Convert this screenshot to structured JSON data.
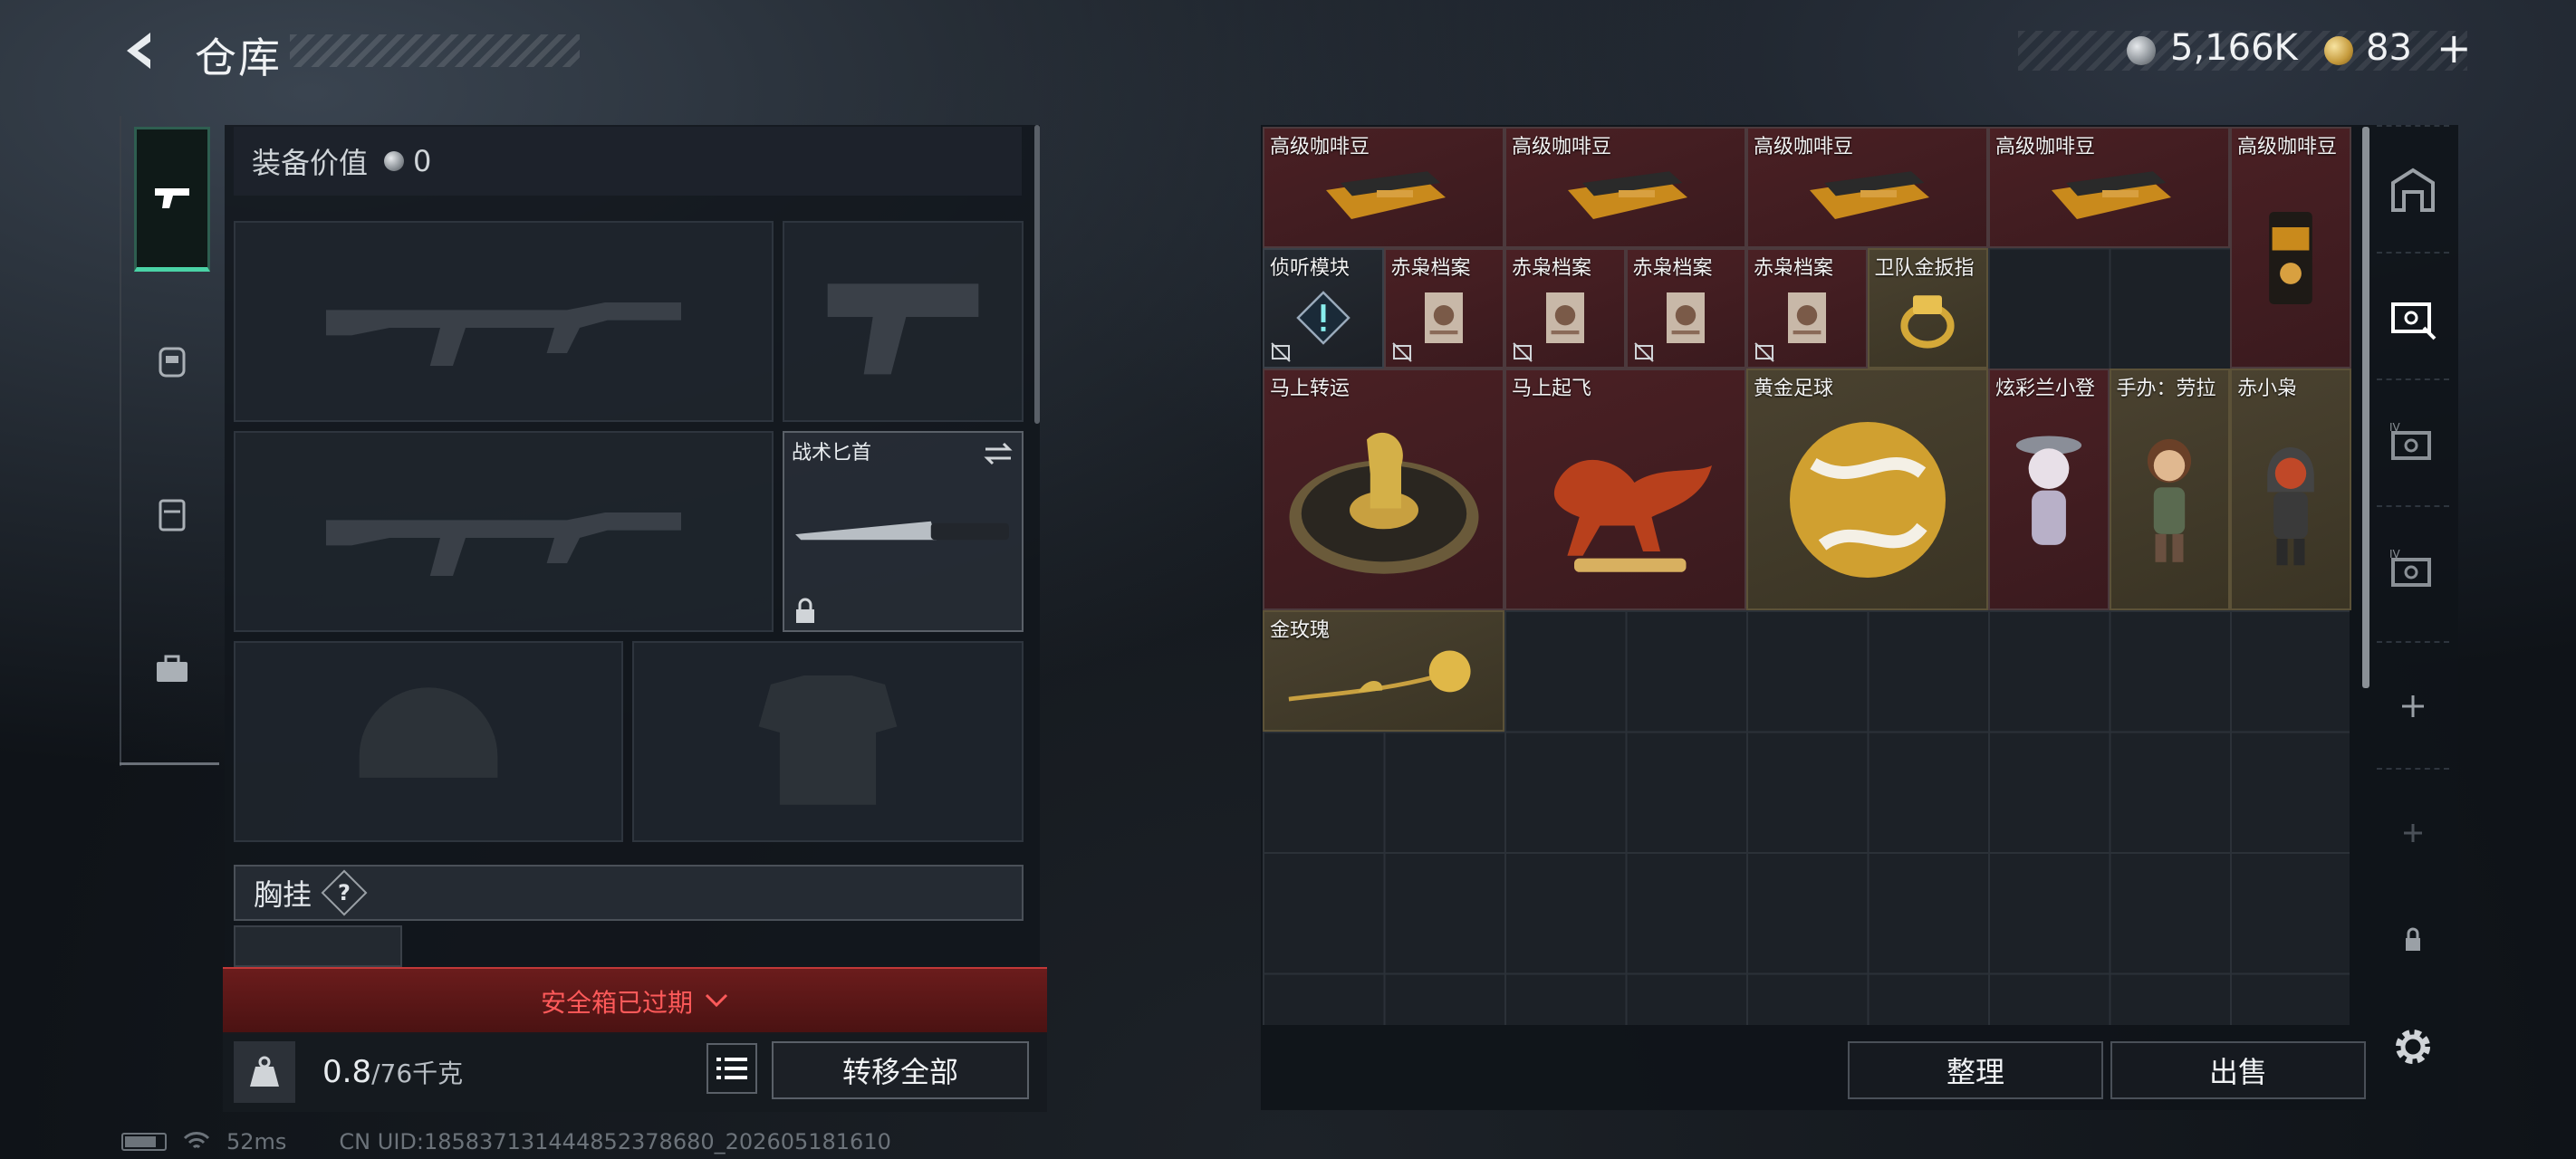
{
  "header": {
    "title": "仓库"
  },
  "currency": {
    "silver": "5,166K",
    "gold": "83",
    "add_label": "+"
  },
  "equipment": {
    "value_label": "装备价值",
    "value": "0",
    "melee_label": "战术匕首",
    "chest_label": "胸挂",
    "chest_help": "?",
    "safebox_expired": "安全箱已过期",
    "weight_current": "0.8",
    "weight_max": "/76千克",
    "transfer_all": "转移全部"
  },
  "inventory": {
    "items": [
      {
        "label": "高级咖啡豆",
        "type": "coffee"
      },
      {
        "label": "高级咖啡豆",
        "type": "coffee"
      },
      {
        "label": "高级咖啡豆",
        "type": "coffee"
      },
      {
        "label": "高级咖啡豆",
        "type": "coffee"
      },
      {
        "label": "高级咖啡豆",
        "type": "coffee-bag"
      },
      {
        "label": "侦听模块",
        "type": "module"
      },
      {
        "label": "赤枭档案",
        "type": "file"
      },
      {
        "label": "赤枭档案",
        "type": "file"
      },
      {
        "label": "赤枭档案",
        "type": "file"
      },
      {
        "label": "赤枭档案",
        "type": "file"
      },
      {
        "label": "卫队金扳指",
        "type": "ring"
      },
      {
        "label": "马上转运",
        "type": "wheel"
      },
      {
        "label": "马上起飞",
        "type": "horse"
      },
      {
        "label": "黄金足球",
        "type": "ball"
      },
      {
        "label": "炫彩兰小登",
        "type": "figure-a"
      },
      {
        "label": "手办：劳拉",
        "type": "figure-b"
      },
      {
        "label": "赤小枭",
        "type": "figure-c"
      },
      {
        "label": "金玫瑰",
        "type": "rose"
      }
    ],
    "sort": "整理",
    "sell": "出售"
  },
  "status": {
    "ping": "52ms",
    "uid": "CN UID:1858371314448523786​80_202605181610"
  },
  "colors": {
    "accent": "#4ad3a6",
    "danger": "#ff5a5a",
    "item_red": "#4a2024",
    "item_gold": "#4a4230"
  }
}
